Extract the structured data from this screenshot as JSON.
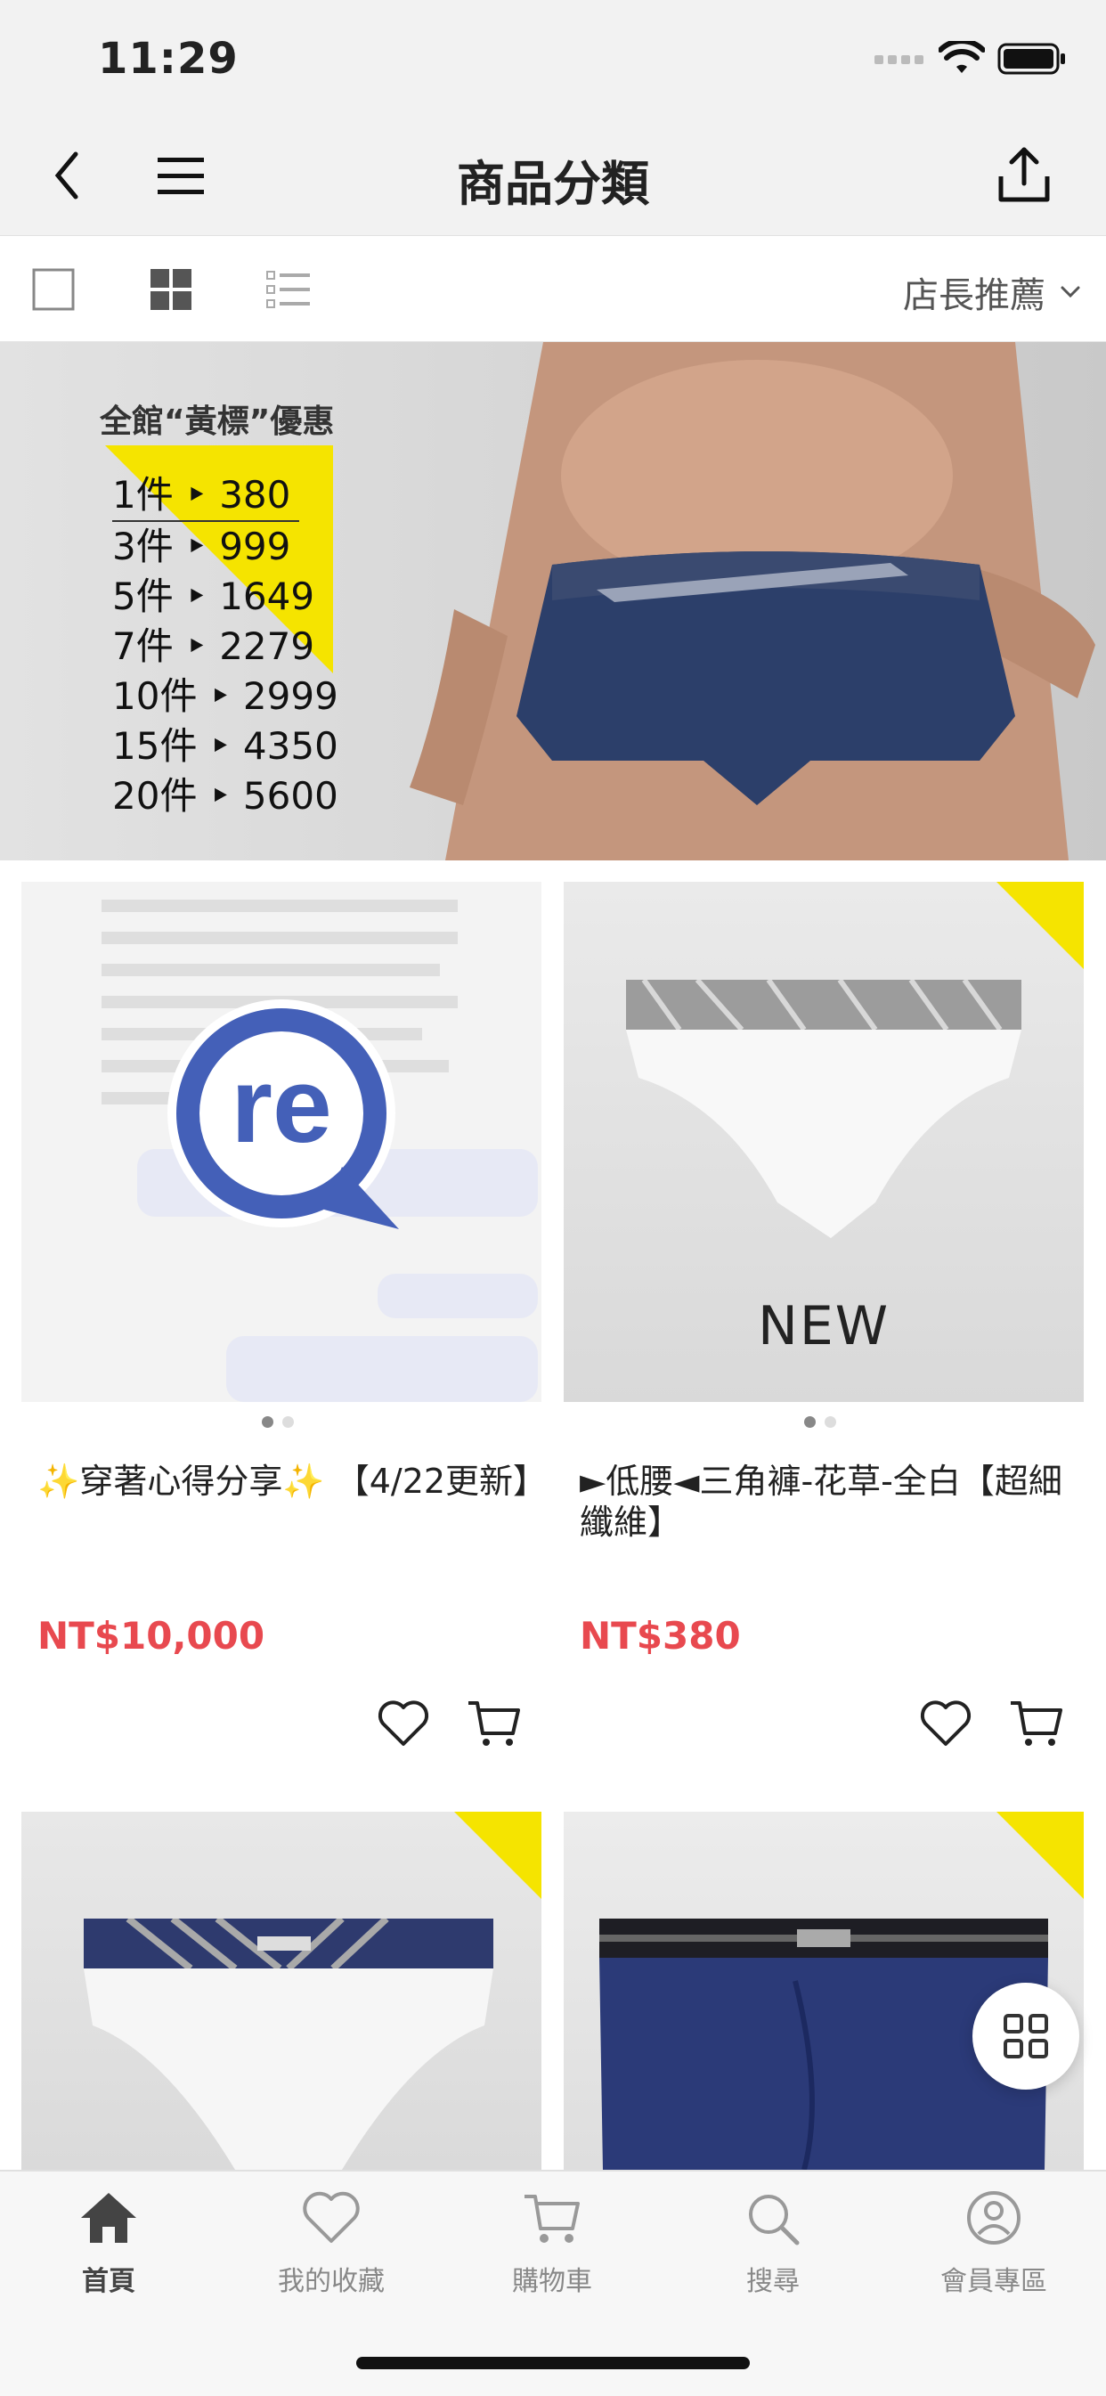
{
  "status": {
    "time": "11:29"
  },
  "nav": {
    "title": "商品分類"
  },
  "toolbar": {
    "sort_label": "店長推薦"
  },
  "banner": {
    "title": "全館“黃標”優惠",
    "prices": [
      "1件 ‣ 380",
      "3件 ‣ 999",
      "5件 ‣ 1649",
      "7件 ‣ 2279",
      "10件 ‣ 2999",
      "15件 ‣ 4350",
      "20件 ‣ 5600"
    ]
  },
  "products": [
    {
      "title": "✨穿著心得分享✨ 【4/22更新】",
      "price": "NT$10,000"
    },
    {
      "title": "►低腰◄三角褲-花草-全白【超細纖維】",
      "price": "NT$380",
      "badge": "NEW"
    }
  ],
  "tabs": [
    {
      "label": "首頁"
    },
    {
      "label": "我的收藏"
    },
    {
      "label": "購物車"
    },
    {
      "label": "搜尋"
    },
    {
      "label": "會員專區"
    }
  ],
  "colors": {
    "accent": "#e8494f",
    "yellow": "#f5e400",
    "brand_blue": "#4460b8"
  }
}
